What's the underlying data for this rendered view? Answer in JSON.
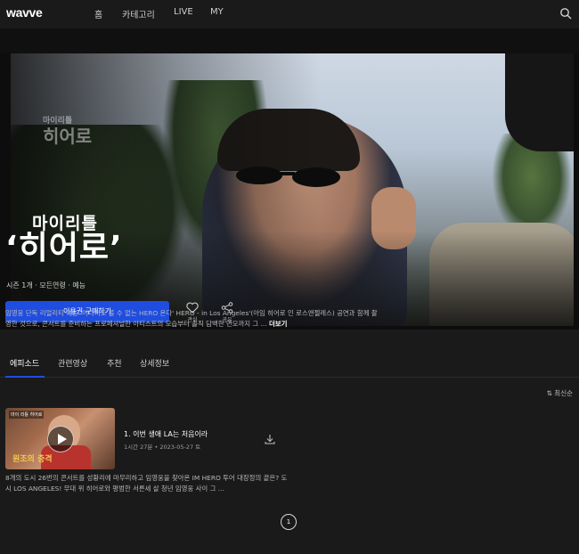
{
  "nav": {
    "logo": "wavve",
    "items": [
      "홈",
      "카테고리",
      "LIVE",
      "MY"
    ]
  },
  "hero": {
    "watermark_small": "마이리틀",
    "watermark_large": "히어로",
    "title_line1": "마이리틀",
    "title_line2": "‘히어로’",
    "meta": "시즌 1개 · 모든연령 · 예능",
    "buy_label": "이용권 구매하기",
    "like_label": "관심",
    "share_label": "공유",
    "description": "임영웅 단독 리얼리티 예능 '어디서도 볼 수 없는 HERO 온다' HERO - in Los Angeles'(아임 히어로 인 로스앤젤레스) 공연과 함께 촬영한 것으로, 콘서트를 준비하는 프로페셔널한 아티스트의 모습부터 솔직 담백한 면모까지 그 ...",
    "more_label": "더보기"
  },
  "tabs": [
    "에피소드",
    "관련영상",
    "추천",
    "상세정보"
  ],
  "sort_label": "⇅ 최신순",
  "episode": {
    "thumb_tag": "마이 리틀 히어로",
    "thumb_caption": "원조의 충격",
    "title": "1. 이번 생애 LA는 처음이라",
    "meta": "1시간 27분 • 2023-05-27 토",
    "description": "8개의 도시 26번의 콘서트를 성황리에 마무리하고 임영웅을 찾아온 IM HERO 투어 대장정의 끝은? 도시 LOS ANGELES! 무대 위 히어로와 평범한 서른세 살 청년 임영웅 사이 그 ..."
  },
  "pagination": {
    "current": "1"
  },
  "colors": {
    "accent": "#1f4de0",
    "background": "#1a1a1a"
  }
}
